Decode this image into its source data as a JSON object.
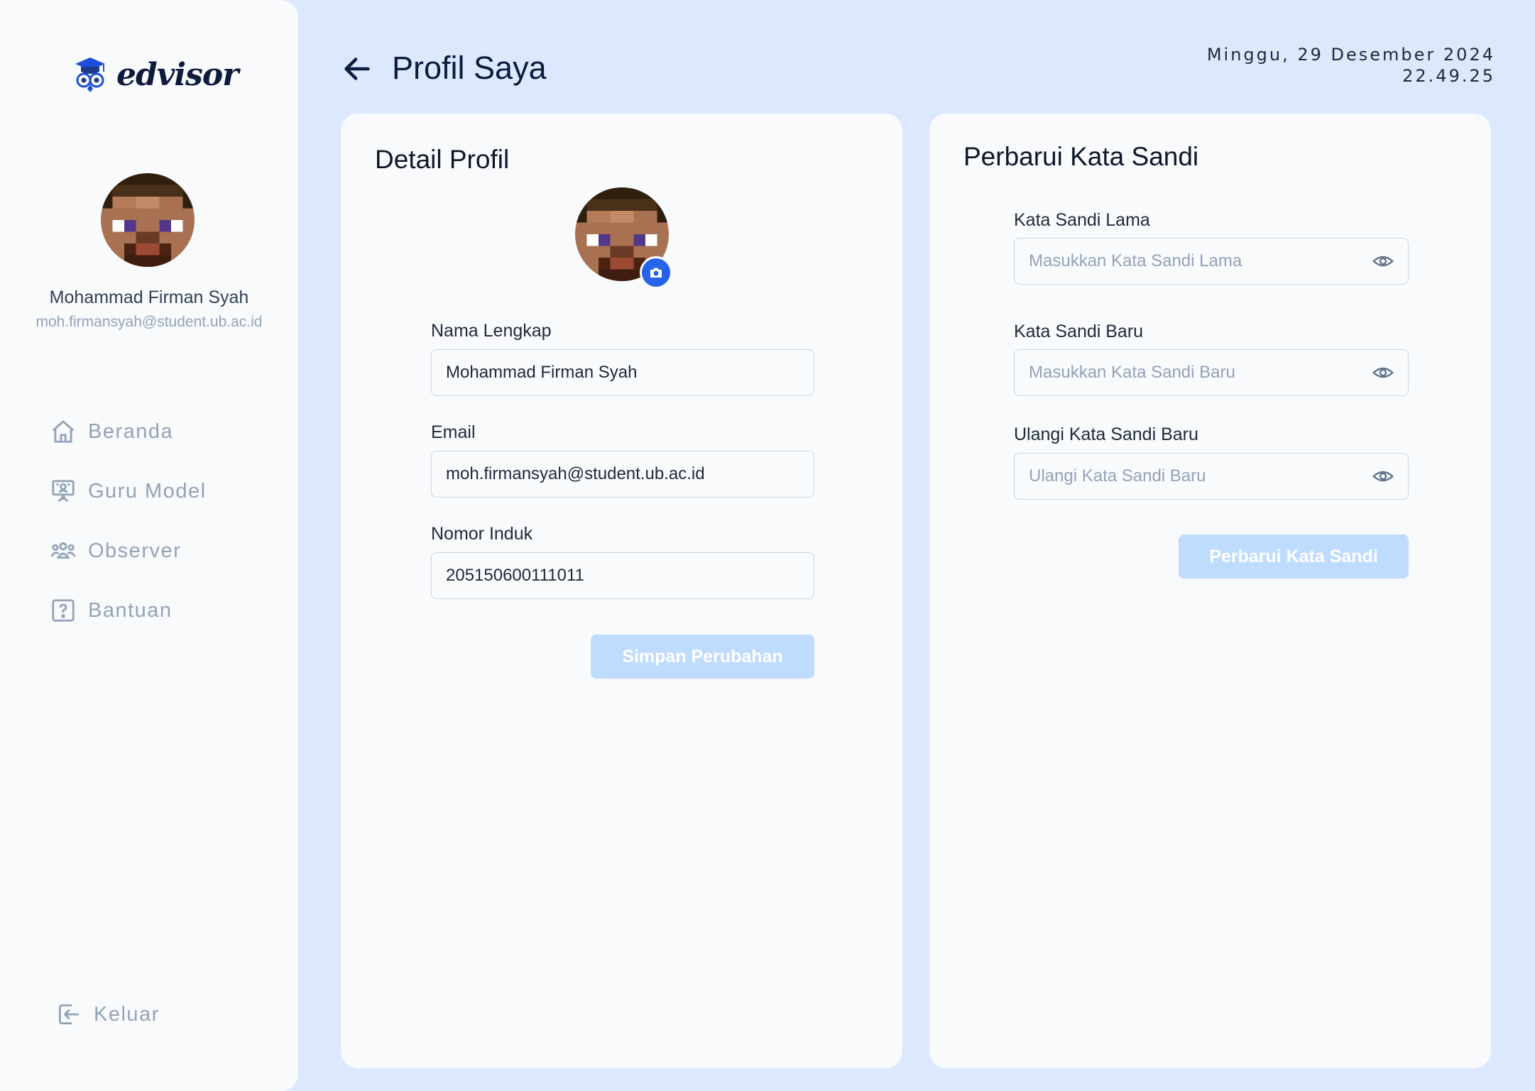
{
  "sidebar": {
    "brand": "edvisor",
    "user": {
      "name": "Mohammad Firman Syah",
      "email": "moh.firmansyah@student.ub.ac.id"
    },
    "nav": [
      {
        "label": "Beranda",
        "icon": "home-icon"
      },
      {
        "label": "Guru Model",
        "icon": "teacher-board-icon"
      },
      {
        "label": "Observer",
        "icon": "users-group-icon"
      },
      {
        "label": "Bantuan",
        "icon": "help-question-icon"
      }
    ],
    "logout": {
      "label": "Keluar",
      "icon": "logout-icon"
    }
  },
  "header": {
    "title": "Profil Saya",
    "date": "Minggu, 29 Desember 2024",
    "time": "22.49.25"
  },
  "profile": {
    "title": "Detail Profil",
    "fields": {
      "full_name": {
        "label": "Nama Lengkap",
        "value": "Mohammad Firman Syah"
      },
      "email": {
        "label": "Email",
        "value": "moh.firmansyah@student.ub.ac.id"
      },
      "id_number": {
        "label": "Nomor Induk",
        "value": "205150600111011"
      }
    },
    "save_button": "Simpan Perubahan"
  },
  "password": {
    "title": "Perbarui Kata Sandi",
    "old": {
      "label": "Kata Sandi Lama",
      "placeholder": "Masukkan Kata Sandi Lama"
    },
    "new": {
      "label": "Kata Sandi Baru",
      "placeholder": "Masukkan Kata Sandi Baru"
    },
    "confirm": {
      "label": "Ulangi Kata Sandi Baru",
      "placeholder": "Ulangi Kata Sandi Baru"
    },
    "update_button": "Perbarui Kata Sandi"
  },
  "colors": {
    "background": "#dbe8fe",
    "panel": "#f8fafc",
    "accent": "#2563eb",
    "button_disabled": "#bfdbfe",
    "muted_text": "#94a3b8"
  }
}
